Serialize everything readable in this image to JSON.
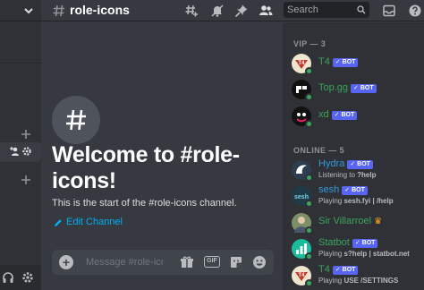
{
  "header": {
    "channel_name": "role-icons",
    "search_placeholder": "Search",
    "icons": [
      "threads-icon",
      "notifications-muted-icon",
      "pin-icon",
      "member-list-icon",
      "inbox-icon",
      "help-icon"
    ]
  },
  "sidebar": {
    "icons": [
      "chevron-down-icon",
      "plus-icon",
      "add-member-icon",
      "gear-icon",
      "headphones-icon"
    ]
  },
  "welcome": {
    "title": "Welcome to #role-icons!",
    "subtitle": "This is the start of the #role-icons channel.",
    "edit_link": "Edit Channel"
  },
  "composer": {
    "placeholder": "Message #role-icons"
  },
  "members": {
    "groups": [
      {
        "label": "VIP — 3",
        "items": [
          {
            "name": "T4",
            "bot": "BOT",
            "activity": "",
            "color": "#3ba55d"
          },
          {
            "name": "Top.gg",
            "bot": "BOT",
            "activity": "",
            "color": "#3ba55d"
          },
          {
            "name": "xd",
            "bot": "BOT",
            "activity": "",
            "color": "#3ba55d"
          }
        ]
      },
      {
        "label": "ONLINE — 5",
        "items": [
          {
            "name": "Hydra",
            "bot": "BOT",
            "activity": "Listening to ?help",
            "color": "#3498db"
          },
          {
            "name": "sesh",
            "bot": "BOT",
            "activity": "Playing sesh.fyi | /help",
            "color": "#3498db"
          },
          {
            "name": "Sir Villarroel",
            "bot": "",
            "activity": "",
            "color": "#3ba55d"
          },
          {
            "name": "Statbot",
            "bot": "BOT",
            "activity": "Playing s?help | statbot.net",
            "color": "#3ba55d"
          },
          {
            "name": "T4",
            "bot": "BOT",
            "activity": "Playing USE /SETTINGS",
            "color": "#3ba55d"
          }
        ]
      }
    ]
  },
  "colors": {
    "accent": "#5865f2",
    "link": "#00aff4",
    "online": "#3ba55d",
    "background": "#36393f",
    "sidebar": "#2f3136"
  }
}
